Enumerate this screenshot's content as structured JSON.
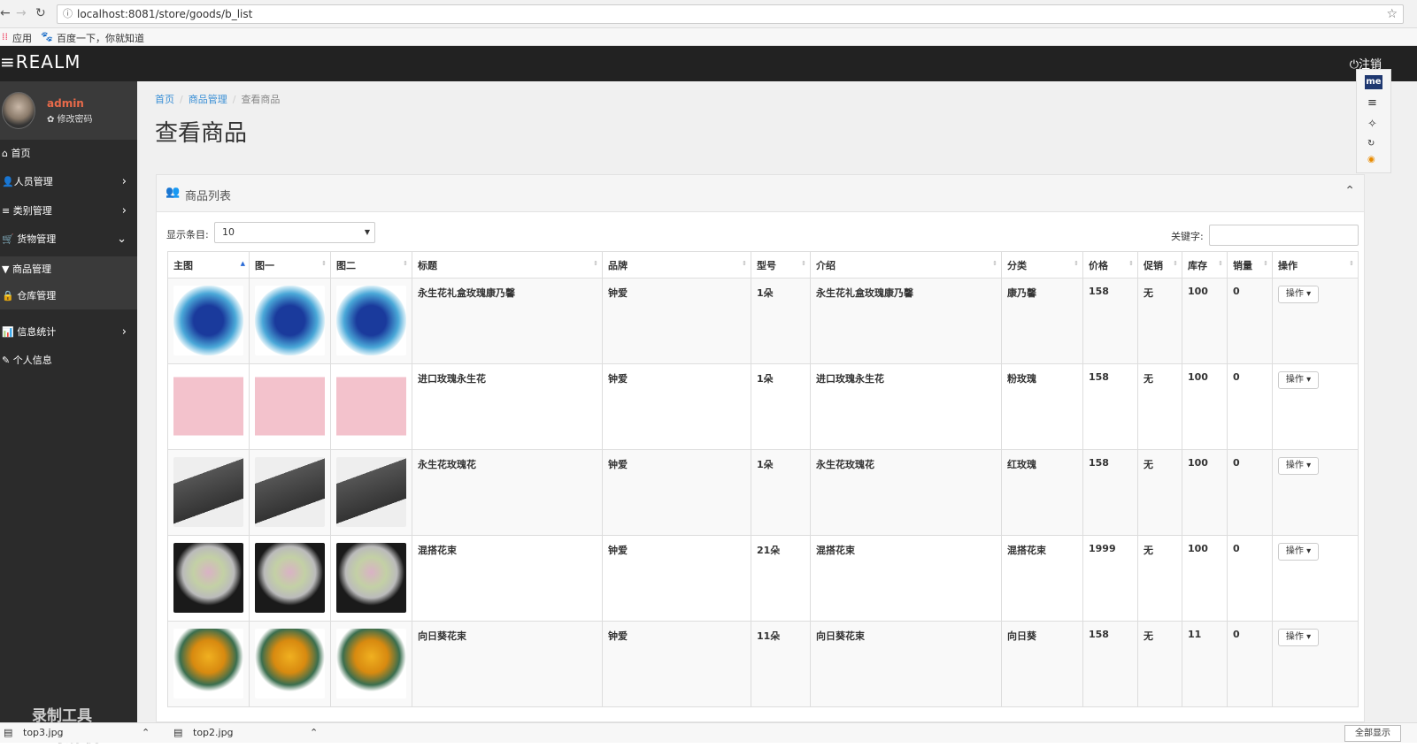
{
  "browser": {
    "url": "localhost:8081/store/goods/b_list"
  },
  "bookmarks": [
    "应用",
    "百度一下，你就知道"
  ],
  "topnav": {
    "brand": "≡REALM",
    "logout": "⏻注销"
  },
  "user": {
    "name": "admin",
    "change_pwd": "✿ 修改密码"
  },
  "menu": [
    {
      "label": "⌂ 首页"
    },
    {
      "label": "👤人员管理"
    },
    {
      "label": "≡ 类别管理"
    },
    {
      "label": "🛒 货物管理"
    },
    {
      "label": "▼ 商品管理"
    },
    {
      "label": "🔒 仓库管理"
    },
    {
      "label": "📊 信息统计"
    },
    {
      "label": "✎ 个人信息"
    }
  ],
  "recorder_watermark": [
    "录制工具",
    "KK 录像机"
  ],
  "breadcrumb": {
    "home": "首页",
    "section": "商品管理",
    "current": "查看商品"
  },
  "page_title": "查看商品",
  "panel": {
    "title": "商品列表",
    "length_label": "显示条目:",
    "length_value": "10",
    "keyword_label": "关键字:"
  },
  "table": {
    "headers": [
      "主图",
      "图一",
      "图二",
      "标题",
      "品牌",
      "型号",
      "介绍",
      "分类",
      "价格",
      "促销",
      "库存",
      "销量",
      "操作"
    ],
    "rows": [
      {
        "title": "永生花礼盒玫瑰康乃馨",
        "brand": "钟爱",
        "model": "1朵",
        "intro": "永生花礼盒玫瑰康乃馨",
        "category": "康乃馨",
        "price": "158",
        "promo": "无",
        "stock": "100",
        "sales": "0",
        "op": "操作 ▾"
      },
      {
        "title": "进口玫瑰永生花",
        "brand": "钟爱",
        "model": "1朵",
        "intro": "进口玫瑰永生花",
        "category": "粉玫瑰",
        "price": "158",
        "promo": "无",
        "stock": "100",
        "sales": "0",
        "op": "操作 ▾"
      },
      {
        "title": "永生花玫瑰花",
        "brand": "钟爱",
        "model": "1朵",
        "intro": "永生花玫瑰花",
        "category": "红玫瑰",
        "price": "158",
        "promo": "无",
        "stock": "100",
        "sales": "0",
        "op": "操作 ▾"
      },
      {
        "title": "混搭花束",
        "brand": "钟爱",
        "model": "21朵",
        "intro": "混搭花束",
        "category": "混搭花束",
        "price": "1999",
        "promo": "无",
        "stock": "100",
        "sales": "0",
        "op": "操作 ▾"
      },
      {
        "title": "向日葵花束",
        "brand": "钟爱",
        "model": "11朵",
        "intro": "向日葵花束",
        "category": "向日葵",
        "price": "158",
        "promo": "无",
        "stock": "11",
        "sales": "0",
        "op": "操作 ▾"
      }
    ]
  },
  "downloads": [
    "top3.jpg",
    "top2.jpg"
  ],
  "show_all": "全部显示",
  "tools": {
    "me": "me"
  }
}
